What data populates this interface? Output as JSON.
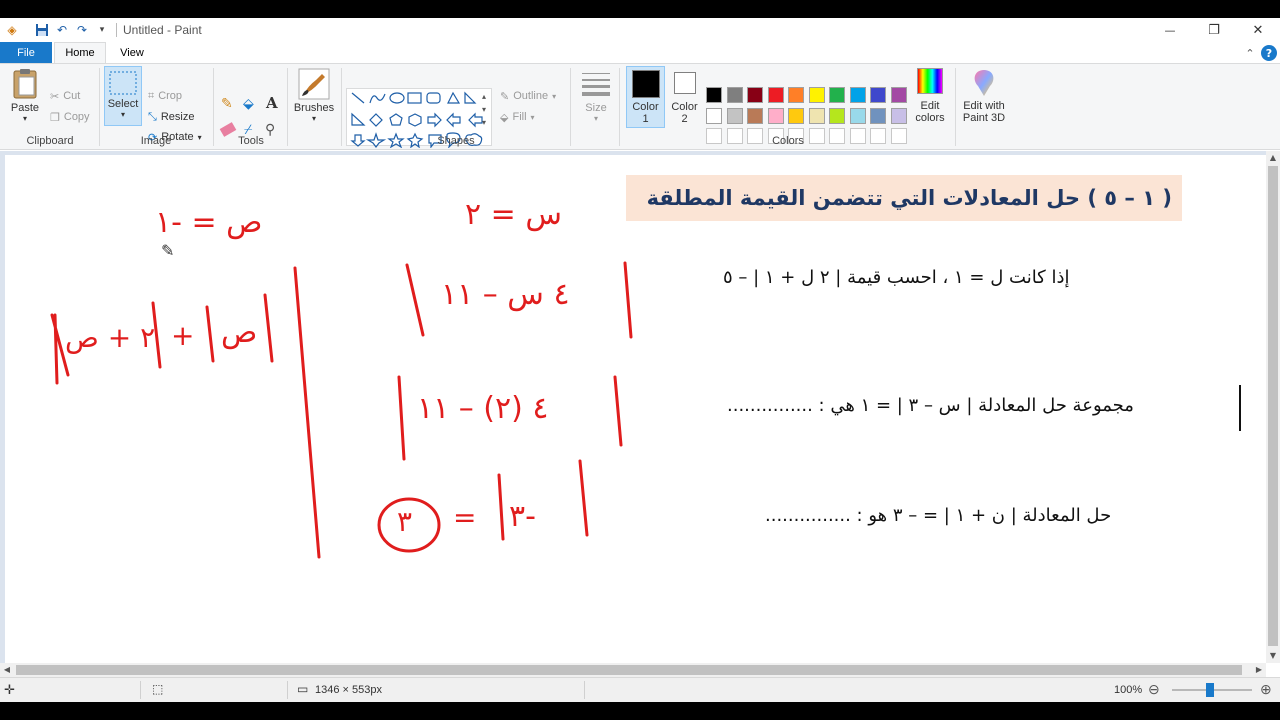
{
  "window": {
    "title": "Untitled - Paint",
    "minimize": "—",
    "restore": "❐",
    "close": "✕"
  },
  "tabs": {
    "file": "File",
    "home": "Home",
    "view": "View"
  },
  "help": {
    "collapse": "⌃",
    "help": "?"
  },
  "ribbon": {
    "clipboard": {
      "paste": "Paste",
      "cut": "Cut",
      "copy": "Copy",
      "label": "Clipboard"
    },
    "image": {
      "select": "Select",
      "crop": "Crop",
      "resize": "Resize",
      "rotate": "Rotate",
      "label": "Image"
    },
    "tools": {
      "label": "Tools"
    },
    "brushes": {
      "label": "Brushes"
    },
    "shapes": {
      "outline": "Outline",
      "fill": "Fill",
      "label": "Shapes"
    },
    "size": {
      "label": "Size"
    },
    "colors": {
      "color1": "Color\n1",
      "color1_line1": "Color",
      "color1_line2": "1",
      "color2_line1": "Color",
      "color2_line2": "2",
      "edit_line1": "Edit",
      "edit_line2": "colors",
      "paint3d_line1": "Edit with",
      "paint3d_line2": "Paint 3D",
      "label": "Colors",
      "row1": [
        "#000000",
        "#7f7f7f",
        "#880015",
        "#ed1c24",
        "#ff7f27",
        "#fff200",
        "#22b14c",
        "#00a2e8",
        "#3f48cc",
        "#a349a4"
      ],
      "row2": [
        "#ffffff",
        "#c3c3c3",
        "#b97a57",
        "#ffaec9",
        "#ffc90e",
        "#efe4b0",
        "#b5e61d",
        "#99d9ea",
        "#7092be",
        "#c8bfe7"
      ],
      "color1_value": "#000000",
      "color2_value": "#ffffff"
    }
  },
  "canvas": {
    "heading": "( ١ – ٥ )  حل المعادلات التي تتضمن القيمة المطلقة",
    "q1": "إذا كانت    ل = ١    ،   احسب قيمة   | ٢ ل  +  ١ | – ٥",
    "q2": "مجموعة حل المعادلة   | س – ٣ |  =  ١    هي :   ...............",
    "q3": "حل المعادلة    | ن + ١ |  =  – ٣      هو  :   ...............",
    "hw_x": "س  =  ٢",
    "hw_y": "ص = -١",
    "hw_abs1": "٤ س  –  ١١",
    "hw_abs2": "٤ (٢)  –  ١١",
    "hw_res1": "-٣",
    "hw_res2": "٣",
    "hw_left1": "ص",
    "hw_left2": "٢ + ص"
  },
  "status": {
    "dimensions": "1346 × 553px",
    "zoom": "100%"
  }
}
